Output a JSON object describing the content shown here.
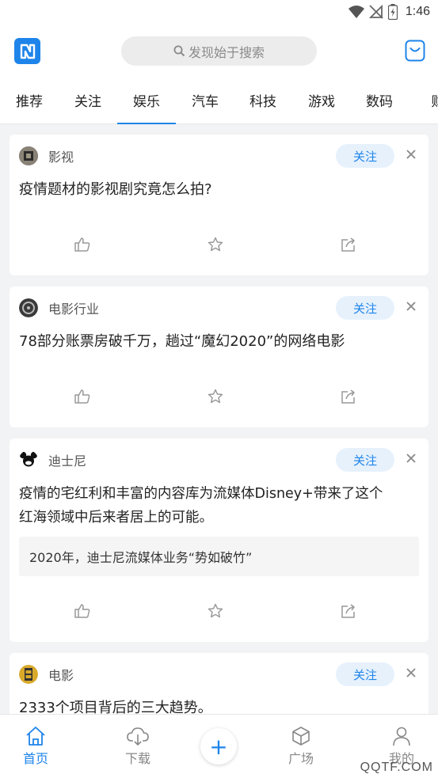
{
  "status_bar": {
    "time": "1:46"
  },
  "header": {
    "search_placeholder": "发现始于搜索"
  },
  "tabs": [
    "推荐",
    "关注",
    "娱乐",
    "汽车",
    "科技",
    "游戏",
    "数码",
    "财"
  ],
  "active_tab": "娱乐",
  "cards": [
    {
      "source": "影视",
      "follow_label": "关注",
      "title_lines": [
        "疫情题材的影视剧究竟怎么拍?"
      ],
      "quote": ""
    },
    {
      "source": "电影行业",
      "follow_label": "关注",
      "title_lines": [
        "78部分账票房破千万，趟过“魔幻2020”的网络电影"
      ],
      "quote": ""
    },
    {
      "source": "迪士尼",
      "follow_label": "关注",
      "title_lines": [
        "疫情的宅红利和丰富的内容库为流媒体Disney+带来了这个",
        "红海领域中后来者居上的可能。"
      ],
      "quote": "2020年，迪士尼流媒体业务“势如破竹”"
    },
    {
      "source": "电影",
      "follow_label": "关注",
      "title_lines": [
        "2333个项目背后的三大趋势。"
      ],
      "quote": ""
    }
  ],
  "bottom_nav": [
    {
      "label": "首页",
      "icon": "home-icon"
    },
    {
      "label": "下载",
      "icon": "cloud-download-icon"
    },
    {
      "label": "广场",
      "icon": "cube-icon"
    },
    {
      "label": "我的",
      "icon": "user-icon"
    }
  ],
  "plus_label": "+",
  "watermark": "QQTF.COM",
  "colors": {
    "accent": "#1e84ea",
    "follow_bg": "#e6f1fc",
    "page_bg": "#f2f3f5"
  }
}
